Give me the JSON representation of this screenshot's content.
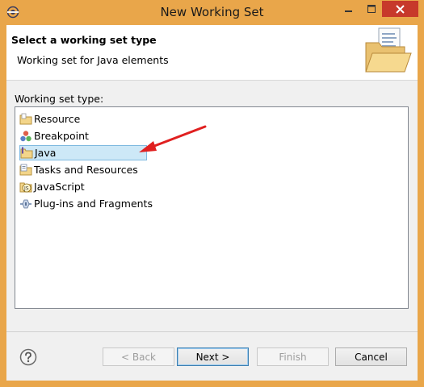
{
  "window": {
    "title": "New Working Set"
  },
  "header": {
    "title": "Select a working set type",
    "description": "Working set for Java elements"
  },
  "list": {
    "label": "Working set type:",
    "items": [
      {
        "label": "Resource",
        "icon": "resource-folder-icon",
        "selected": false
      },
      {
        "label": "Breakpoint",
        "icon": "breakpoint-icon",
        "selected": false
      },
      {
        "label": "Java",
        "icon": "java-folder-icon",
        "selected": true
      },
      {
        "label": "Tasks and Resources",
        "icon": "tasks-icon",
        "selected": false
      },
      {
        "label": "JavaScript",
        "icon": "javascript-icon",
        "selected": false
      },
      {
        "label": "Plug-ins and Fragments",
        "icon": "plugin-icon",
        "selected": false
      }
    ]
  },
  "buttons": {
    "back": "< Back",
    "next": "Next >",
    "finish": "Finish",
    "cancel": "Cancel"
  },
  "colors": {
    "titlebar": "#e9a64a",
    "close": "#c7392b",
    "selection": "#cde8f7",
    "annotation_arrow": "#e02020"
  }
}
